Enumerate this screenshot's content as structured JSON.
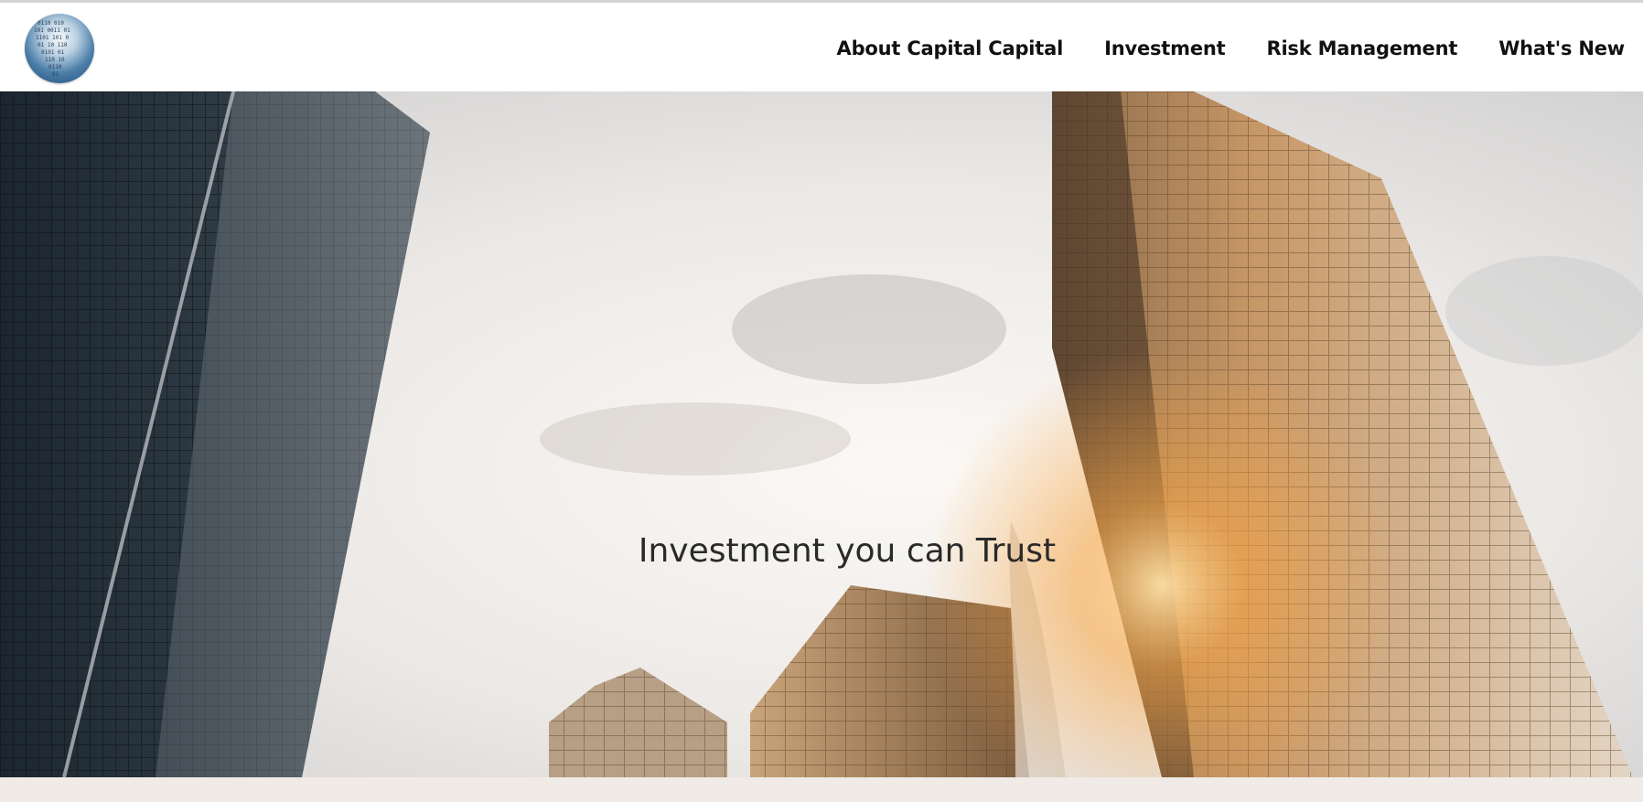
{
  "header": {
    "logo_icon": "binary-globe-logo-icon",
    "nav": [
      {
        "label": "About Capital Capital"
      },
      {
        "label": "Investment"
      },
      {
        "label": "Risk Management"
      },
      {
        "label": "What's New"
      }
    ]
  },
  "hero": {
    "tagline": "Investment you can Trust",
    "background_icon": "skyscrapers-photo"
  },
  "colors": {
    "nav_text": "#111111",
    "tagline": "#2a2a2a",
    "bottom_strip": "#f0ebe6",
    "sun_glow": "#f7a84a"
  }
}
